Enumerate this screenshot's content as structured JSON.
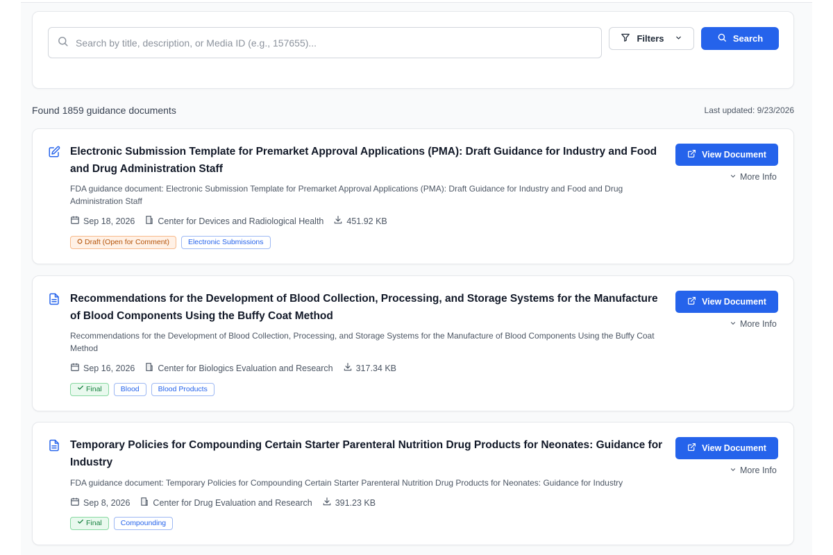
{
  "search": {
    "placeholder": "Search by title, description, or Media ID (e.g., 157655)...",
    "value": "",
    "filters_label": "Filters",
    "search_label": "Search"
  },
  "results": {
    "summary": "Found 1859 guidance documents",
    "last_updated": "Last updated: 9/23/2026"
  },
  "documents": [
    {
      "title": "Electronic Submission Template for Premarket Approval Applications (PMA): Draft Guidance for Industry and Food and Drug Administration Staff",
      "description": "FDA guidance document: Electronic Submission Template for Premarket Approval Applications (PMA): Draft Guidance for Industry and Food and Drug Administration Staff",
      "date": "Sep 18, 2026",
      "center": "Center for Devices and Radiological Health",
      "size": "451.92 KB",
      "status": "Draft (Open for Comment)",
      "topics": [
        "Electronic Submissions"
      ],
      "icon": "edit-icon"
    },
    {
      "title": "Recommendations for the Development of Blood Collection, Processing, and Storage Systems for the Manufacture of Blood Components Using the Buffy Coat Method",
      "description": "Recommendations for the Development of Blood Collection, Processing, and Storage Systems for the Manufacture of Blood Components Using the Buffy Coat Method",
      "date": "Sep 16, 2026",
      "center": "Center for Biologics Evaluation and Research",
      "size": "317.34 KB",
      "status": "Final",
      "topics": [
        "Blood",
        "Blood Products"
      ],
      "icon": "document-icon"
    },
    {
      "title": "Temporary Policies for Compounding Certain Starter Parenteral Nutrition Drug Products for Neonates: Guidance for Industry",
      "description": "FDA guidance document: Temporary Policies for Compounding Certain Starter Parenteral Nutrition Drug Products for Neonates: Guidance for Industry",
      "date": "Sep 8, 2026",
      "center": "Center for Drug Evaluation and Research",
      "size": "391.23 KB",
      "status": "Final",
      "topics": [
        "Compounding"
      ],
      "icon": "document-icon"
    }
  ],
  "labels": {
    "view_document": "View Document",
    "more_info": "More Info"
  },
  "colors": {
    "accent": "#2563eb",
    "draft_bg": "#fff1e6",
    "draft_text": "#b45309",
    "final_bg": "#e9f9ee",
    "final_text": "#15803d"
  }
}
